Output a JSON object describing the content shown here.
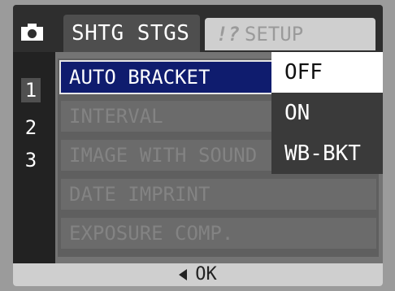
{
  "tabs": {
    "active_label": "SHTG STGS",
    "inactive_label": "SETUP",
    "inactive_icon_label": "!?"
  },
  "menu_numbers": [
    "1",
    "2",
    "3"
  ],
  "menu_items": [
    {
      "label": "AUTO BRACKET",
      "selected": true
    },
    {
      "label": "INTERVAL",
      "selected": false
    },
    {
      "label": "IMAGE WITH SOUND",
      "selected": false
    },
    {
      "label": "DATE IMPRINT",
      "selected": false
    },
    {
      "label": "EXPOSURE COMP.",
      "selected": false
    }
  ],
  "popup_options": [
    {
      "label": "OFF",
      "selected": true
    },
    {
      "label": "ON",
      "selected": false
    },
    {
      "label": "WB-BKT",
      "selected": false
    }
  ],
  "footer": {
    "ok_label": "OK"
  },
  "icons": {
    "camera": "camera-icon",
    "setup": "setup-icon",
    "left_arrow": "left-arrow-icon"
  }
}
